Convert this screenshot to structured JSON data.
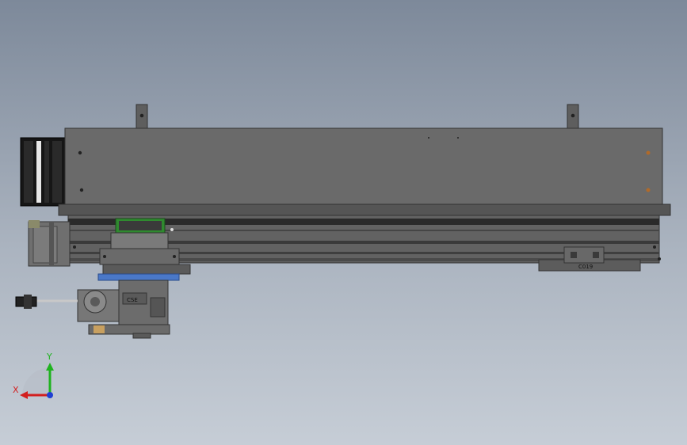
{
  "viewport": {
    "background_top": "#7d899a",
    "background_bottom": "#c6cdd6"
  },
  "model": {
    "housing_color": "#6a6a6a",
    "rail_color": "#5e5e5e",
    "carriage_color": "#7a7a7a",
    "carriage_accent": "#2f8a2f",
    "blue_plate_color": "#4a78c8",
    "motor_color": "#6f6f6f",
    "cable_chain_color": "#1a1a1a",
    "limit_block_label": "C019",
    "head_label": "CSE"
  },
  "triad": {
    "x_label": "X",
    "y_label": "Y",
    "x_color": "#d21f1f",
    "y_color": "#1fb31f",
    "z_color": "#1f3fd2"
  }
}
